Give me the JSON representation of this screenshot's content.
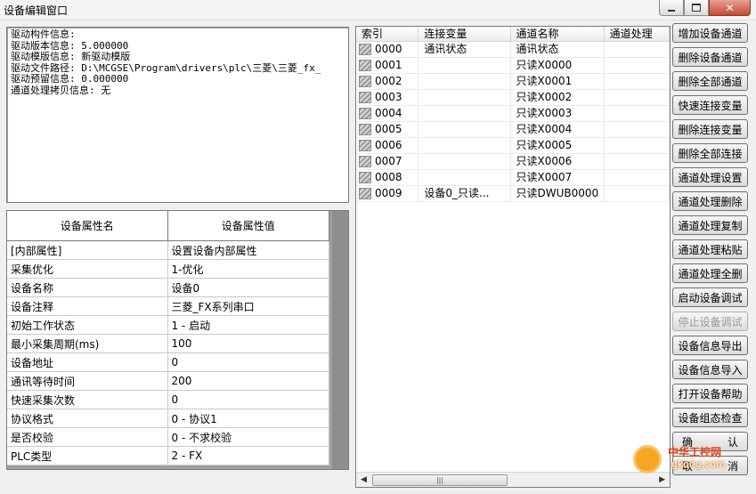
{
  "window": {
    "title": "设备编辑窗口"
  },
  "info": {
    "lines": [
      "驱动构件信息:",
      "驱动版本信息: 5.000000",
      "驱动模版信息: 新驱动模版",
      "驱动文件路径: D:\\MCGSE\\Program\\drivers\\plc\\三菱\\三菱_fx_",
      "驱动预留信息: 0.000000",
      "通道处理拷贝信息: 无"
    ]
  },
  "props": {
    "header_name": "设备属性名",
    "header_value": "设备属性值",
    "rows": [
      {
        "name": "[内部属性]",
        "value": "设置设备内部属性"
      },
      {
        "name": "采集优化",
        "value": "1-优化"
      },
      {
        "name": "设备名称",
        "value": "设备0"
      },
      {
        "name": "设备注释",
        "value": "三菱_FX系列串口"
      },
      {
        "name": "初始工作状态",
        "value": "1 - 启动"
      },
      {
        "name": "最小采集周期(ms)",
        "value": "100"
      },
      {
        "name": "设备地址",
        "value": "0"
      },
      {
        "name": "通讯等待时间",
        "value": "200"
      },
      {
        "name": "快速采集次数",
        "value": "0"
      },
      {
        "name": "协议格式",
        "value": "0 - 协议1"
      },
      {
        "name": "是否校验",
        "value": "0 - 不求校验"
      },
      {
        "name": "PLC类型",
        "value": "2 - FX"
      }
    ]
  },
  "channels": {
    "headers": [
      "索引",
      "连接变量",
      "通道名称",
      "通道处理"
    ],
    "rows": [
      {
        "index": "0000",
        "var": "通讯状态",
        "name": "通讯状态",
        "proc": ""
      },
      {
        "index": "0001",
        "var": "",
        "name": "只读X0000",
        "proc": ""
      },
      {
        "index": "0002",
        "var": "",
        "name": "只读X0001",
        "proc": ""
      },
      {
        "index": "0003",
        "var": "",
        "name": "只读X0002",
        "proc": ""
      },
      {
        "index": "0004",
        "var": "",
        "name": "只读X0003",
        "proc": ""
      },
      {
        "index": "0005",
        "var": "",
        "name": "只读X0004",
        "proc": ""
      },
      {
        "index": "0006",
        "var": "",
        "name": "只读X0005",
        "proc": ""
      },
      {
        "index": "0007",
        "var": "",
        "name": "只读X0006",
        "proc": ""
      },
      {
        "index": "0008",
        "var": "",
        "name": "只读X0007",
        "proc": ""
      },
      {
        "index": "0009",
        "var": "设备0_只读...",
        "name": "只读DWUB0000",
        "proc": ""
      }
    ]
  },
  "buttons": {
    "add_channel": "增加设备通道",
    "delete_channel": "删除设备通道",
    "delete_all_channels": "删除全部通道",
    "quick_connect": "快速连接变量",
    "delete_connection": "删除连接变量",
    "delete_all_connections": "删除全部连接",
    "proc_settings": "通道处理设置",
    "proc_delete": "通道处理删除",
    "proc_copy": "通道处理复制",
    "proc_paste": "通道处理粘贴",
    "proc_delete_all": "通道处理全删",
    "start_debug": "启动设备调试",
    "stop_debug": "停止设备调试",
    "export_info": "设备信息导出",
    "import_info": "设备信息导入",
    "open_help": "打开设备帮助",
    "config_check": "设备组态检查",
    "ok_left": "确",
    "ok_right": "认",
    "cancel_left": "取",
    "cancel_right": "消"
  },
  "watermark": {
    "brand": "中华工控网",
    "url": "gkong.com"
  }
}
